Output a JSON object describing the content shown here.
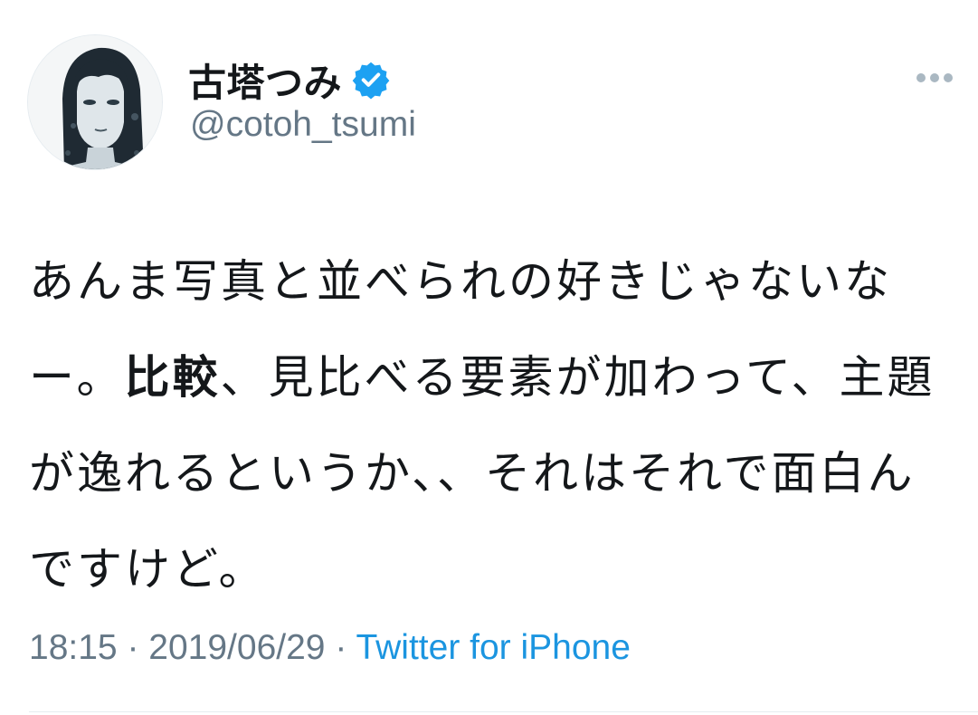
{
  "tweet": {
    "author": {
      "display_name": "古塔つみ",
      "handle": "@cotoh_tsumi",
      "verified_icon": "verified-badge-icon",
      "avatar": "illustrated-portrait-avatar"
    },
    "more_icon": "more-options-icon",
    "text": {
      "part1": "あんま写真と並べられの好きじゃないなー。",
      "strong": "比較",
      "part2": "、見比べる要素が加わって、主題が逸れるというか、、それはそれで面白んですけど。"
    },
    "meta": {
      "time": "18:15",
      "separator1": " · ",
      "date": "2019/06/29",
      "separator2": " · ",
      "source": "Twitter for iPhone"
    },
    "colors": {
      "text": "#14171a",
      "secondary": "#657786",
      "link": "#1b95e0",
      "verified": "#1da1f2",
      "divider": "#e6ecf0"
    }
  }
}
